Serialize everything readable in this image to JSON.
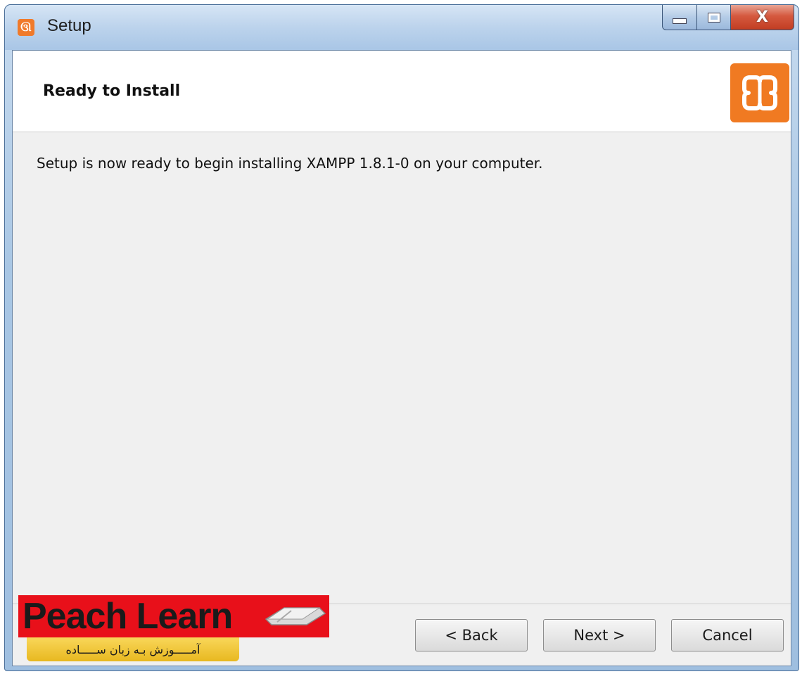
{
  "window": {
    "title": "Setup",
    "icon": "xampp-icon",
    "minimize_label": "",
    "maximize_label": "",
    "close_label": "X"
  },
  "header": {
    "title": "Ready to Install",
    "logo_icon": "xampp-logo-icon"
  },
  "body": {
    "message": "Setup is now ready to begin installing XAMPP 1.8.1-0 on your computer."
  },
  "buttons": {
    "back": "< Back",
    "next": "Next >",
    "cancel": "Cancel"
  },
  "watermark": {
    "brand": "Peach Learn",
    "tagline": "آمـــــوزش بـه زبان ســـــاده"
  },
  "colors": {
    "accent_orange": "#f07a22",
    "watermark_red": "#e8101a",
    "watermark_yellow": "#f2c93a"
  }
}
